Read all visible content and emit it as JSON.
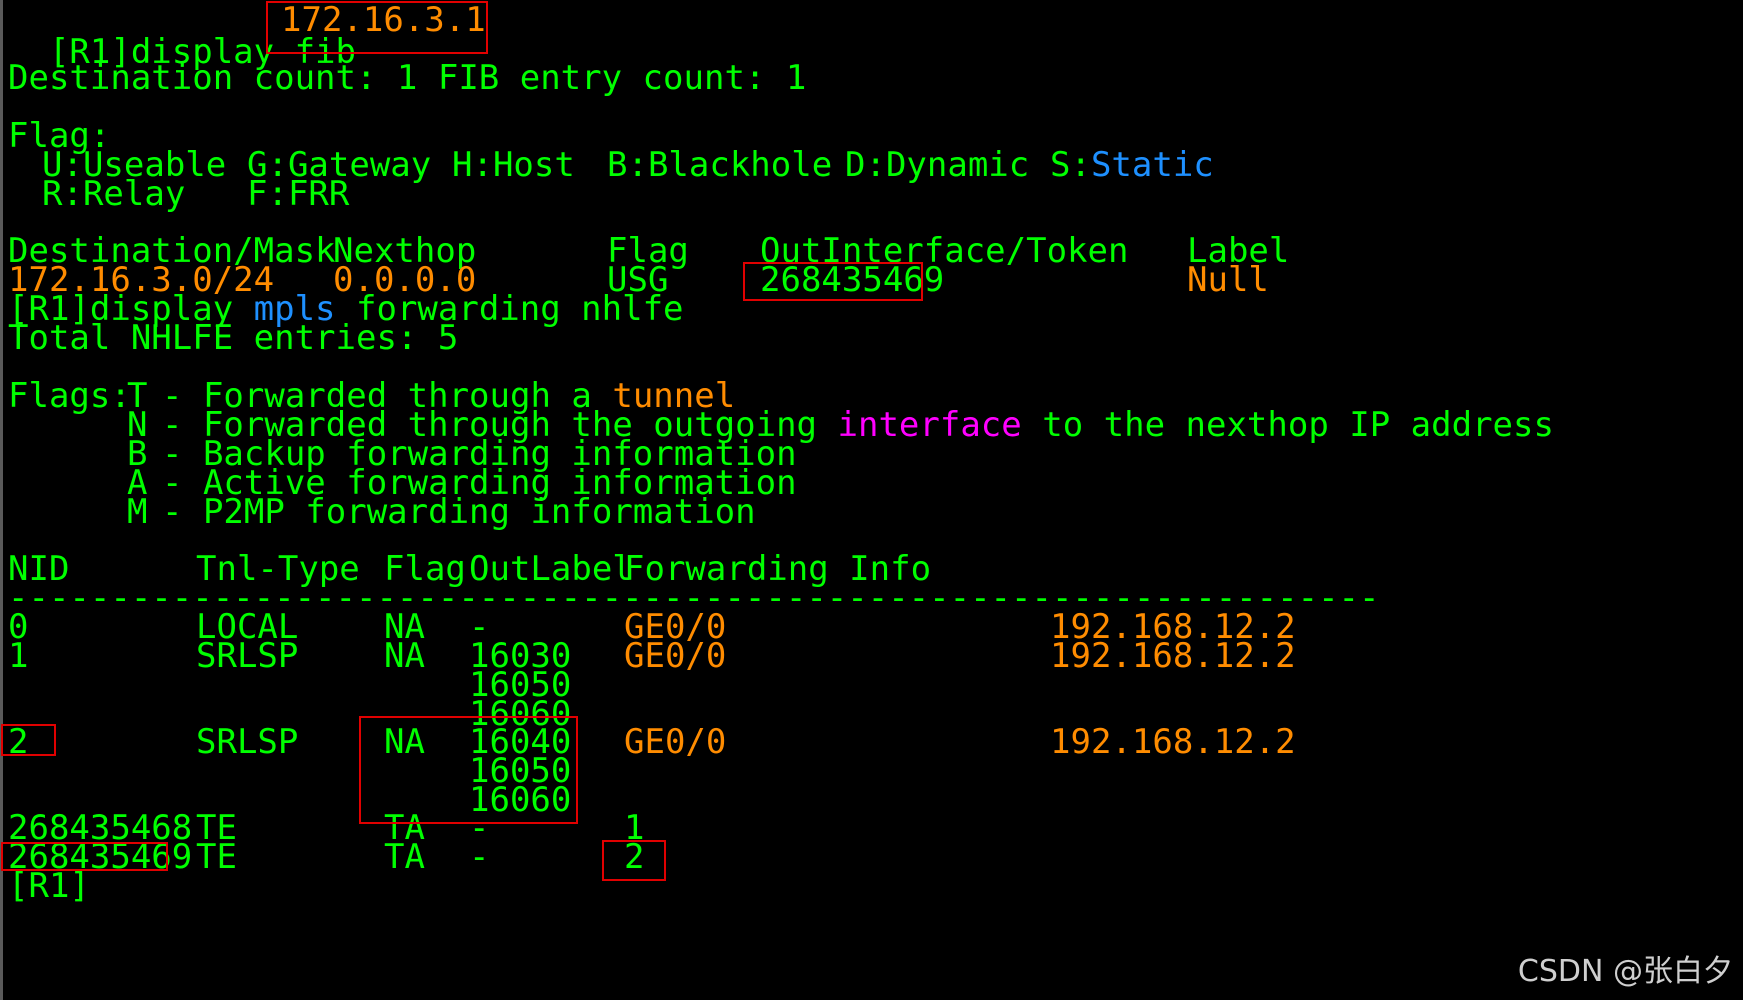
{
  "terminal": {
    "l0": "[R1]display fib",
    "ip_arg": "172.16.3.1",
    "dest_count": "Destination count: 1 FIB entry count: 1",
    "flag_title": "Flag:",
    "flags": {
      "u": "U:Useable",
      "g": "G:Gateway",
      "h": "H:Host",
      "b": "B:Blackhole",
      "d": "D:Dynamic",
      "s_prefix": "S:",
      "s_word": "Static",
      "r": "R:Relay",
      "f": "F:FRR"
    },
    "fib_headers": {
      "dest": "Destination/Mask",
      "nexthop": "Nexthop",
      "flag": "Flag",
      "outif": "OutInterface/Token",
      "label": "Label"
    },
    "fib_row": {
      "dest": "172.16.3.0/24",
      "nexthop": "0.0.0.0",
      "flag": "USG",
      "outif": "268435469",
      "label": "Null"
    },
    "cmd2_a": "[R1]display ",
    "cmd2_mpls": "mpls",
    "cmd2_b": " forwarding nhlfe",
    "total": "Total NHLFE entries: 5",
    "flags2": {
      "label": "Flags:",
      "t_key": "T",
      "t_a": "- Forwarded through a ",
      "t_tunnel": "tunnel",
      "n_key": "N",
      "n_a": "- Forwarded through the outgoing ",
      "n_interface": "interface",
      "n_b": " to the nexthop IP address",
      "b_key": "B",
      "b_a": "- Backup forwarding information",
      "a_key": "A",
      "a_a": "- Active forwarding information",
      "m_key": "M",
      "m_a": "- P2MP forwarding information"
    },
    "nhlfe_headers": {
      "nid": "NID",
      "tnl": "Tnl-Type",
      "flag": "Flag",
      "outlabel": "OutLabel",
      "fwd": "Forwarding Info"
    },
    "separator": "--------------------------------------------------------------------------------",
    "rows": [
      {
        "nid": "0",
        "tnl": "LOCAL",
        "flag": "NA",
        "out": "-",
        "fwd": "GE0/0",
        "ip": "192.168.12.2"
      },
      {
        "nid": "1",
        "tnl": "SRLSP",
        "flag": "NA",
        "out": "16030",
        "fwd": "GE0/0",
        "ip": "192.168.12.2"
      },
      {
        "out": "16050"
      },
      {
        "out": "16060"
      },
      {
        "nid": "2",
        "tnl": "SRLSP",
        "flag": "NA",
        "out": "16040",
        "fwd": "GE0/0",
        "ip": "192.168.12.2"
      },
      {
        "out": "16050"
      },
      {
        "out": "16060"
      },
      {
        "nid": "268435468",
        "tnl": "TE",
        "flag": "TA",
        "out": "-",
        "fwd": "1"
      },
      {
        "nid": "268435469",
        "tnl": "TE",
        "flag": "TA",
        "out": "-",
        "fwd": "2"
      }
    ],
    "prompt": "[R1]"
  },
  "watermark": "CSDN @张白夕",
  "colors": {
    "background": "#000000",
    "text_green": "#00ff00",
    "value_orange": "#ff8c00",
    "keyword_blue": "#1e90ff",
    "keyword_magenta": "#ff00ff",
    "highlight_red": "#e10000"
  }
}
